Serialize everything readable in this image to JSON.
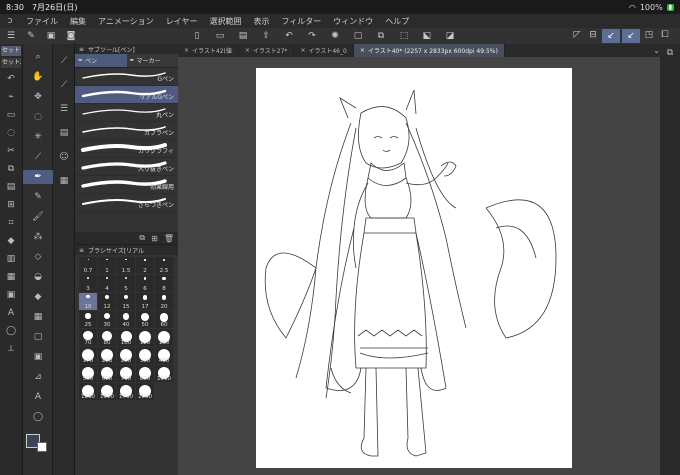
{
  "status_bar": {
    "time": "8:30",
    "date": "7月26日(日)",
    "battery": "100%"
  },
  "menu": {
    "items": [
      "ファイル",
      "編集",
      "アニメーション",
      "レイヤー",
      "選択範囲",
      "表示",
      "フィルター",
      "ウィンドウ",
      "ヘルプ"
    ]
  },
  "left": {
    "set_buttons": [
      "セット1",
      "セット2"
    ]
  },
  "subtool": {
    "header": "サブツール[ペン]",
    "tabs": [
      "ペン",
      "マーカー"
    ],
    "brushes": [
      {
        "name": "Gペン",
        "selected": false
      },
      {
        "name": "リアルGペン",
        "selected": true
      },
      {
        "name": "丸ペン",
        "selected": false
      },
      {
        "name": "カブラペン",
        "selected": false
      },
      {
        "name": "カリグラフィ",
        "selected": false
      },
      {
        "name": "入り抜きペン",
        "selected": false
      },
      {
        "name": "効果線用",
        "selected": false
      },
      {
        "name": "ざらつきペン",
        "selected": false
      }
    ]
  },
  "brush_size": {
    "header": "ブラシサイズ[リアル",
    "sizes": [
      "0.7",
      "1",
      "1.5",
      "2",
      "2.5",
      "3",
      "4",
      "5",
      "6",
      "8",
      "10",
      "12",
      "15",
      "17",
      "20",
      "25",
      "30",
      "40",
      "50",
      "60",
      "70",
      "80",
      "100",
      "120",
      "150",
      "170",
      "200",
      "250",
      "300",
      "400",
      "500",
      "600",
      "700",
      "800",
      "1000",
      "1200",
      "1500",
      "1700",
      "2000"
    ],
    "selected": "10"
  },
  "tabs": [
    {
      "label": "イラスト42(値",
      "active": false
    },
    {
      "label": "イラスト27*",
      "active": false
    },
    {
      "label": "イラスト46_0",
      "active": false
    },
    {
      "label": "イラスト40* (2257 x 2833px 600dpi 49.5%)",
      "active": true
    }
  ]
}
